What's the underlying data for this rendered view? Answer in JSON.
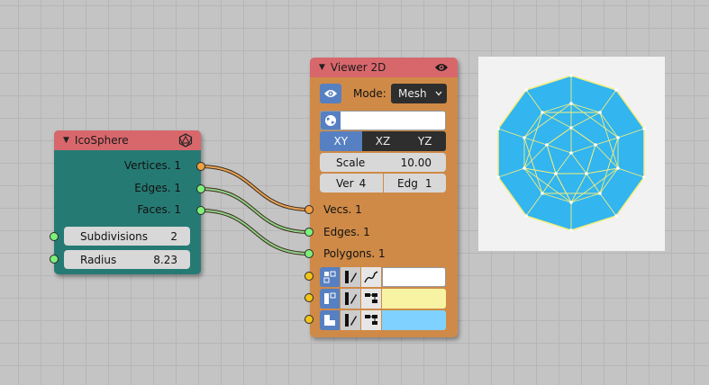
{
  "icosphere": {
    "title": "IcoSphere",
    "outputs": [
      "Vertices. 1",
      "Edges. 1",
      "Faces. 1"
    ],
    "subdivisions_label": "Subdivisions",
    "subdivisions_value": "2",
    "radius_label": "Radius",
    "radius_value": "8.23",
    "header_color": "#d8676c",
    "body_color": "#267a74"
  },
  "viewer": {
    "title": "Viewer 2D",
    "mode_label": "Mode:",
    "mode_value": "Mesh",
    "planes": [
      "XY",
      "XZ",
      "YZ"
    ],
    "active_plane": "XY",
    "scale_label": "Scale",
    "scale_value": "10.00",
    "ver_label": "Ver",
    "ver_value": "4",
    "edg_label": "Edg",
    "edg_value": "1",
    "inputs": [
      "Vecs. 1",
      "Edges. 1",
      "Polygons. 1"
    ],
    "header_color": "#d8676c",
    "body_color": "#cf8a47",
    "color_swatches": [
      "#ffffff",
      "#f8f3a3",
      "#7fd2ff"
    ]
  },
  "preview": {
    "fill_color": "#33b5ef",
    "edge_color": "#f4ee7c"
  }
}
